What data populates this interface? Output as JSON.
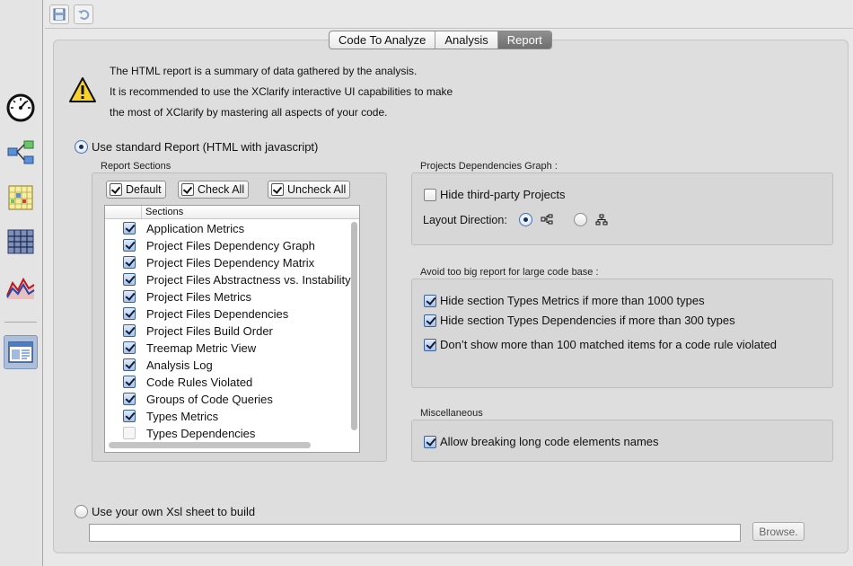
{
  "tabs": [
    "Code To Analyze",
    "Analysis",
    "Report"
  ],
  "active_tab": "Report",
  "sidebar": {
    "items": [
      {
        "icon": "gauge-icon"
      },
      {
        "icon": "dependency-graph-icon"
      },
      {
        "icon": "dependency-matrix-icon"
      },
      {
        "icon": "treemap-icon"
      },
      {
        "icon": "trend-chart-icon"
      },
      {
        "icon": "report-window-icon",
        "selected": true
      }
    ]
  },
  "toolbar": {
    "icons": [
      "save-icon",
      "undo-icon"
    ]
  },
  "info": {
    "line1": "The HTML report is a summary of data gathered by the analysis.",
    "line2": "It is recommended to use the XClarify interactive UI capabilities to make",
    "line3": "the most of XClarify by mastering all aspects of your code."
  },
  "standard_report": {
    "label": "Use standard Report (HTML with javascript)",
    "selected": true
  },
  "report_sections": {
    "title": "Report Sections",
    "buttons": {
      "default": "Default",
      "check_all": "Check All",
      "uncheck_all": "Uncheck All"
    },
    "column_header": "Sections",
    "items": [
      {
        "label": "Application Metrics",
        "checked": true
      },
      {
        "label": "Project Files Dependency Graph",
        "checked": true
      },
      {
        "label": "Project Files Dependency Matrix",
        "checked": true
      },
      {
        "label": "Project Files Abstractness vs. Instability",
        "checked": true
      },
      {
        "label": "Project Files Metrics",
        "checked": true
      },
      {
        "label": "Project Files Dependencies",
        "checked": true
      },
      {
        "label": "Project Files Build Order",
        "checked": true
      },
      {
        "label": "Treemap Metric View",
        "checked": true
      },
      {
        "label": "Analysis Log",
        "checked": true
      },
      {
        "label": "Code Rules Violated",
        "checked": true
      },
      {
        "label": "Groups of Code Queries",
        "checked": true
      },
      {
        "label": "Types Metrics",
        "checked": true
      },
      {
        "label": "Types Dependencies",
        "checked": false
      }
    ]
  },
  "dependencies_graph": {
    "title": "Projects Dependencies Graph :",
    "hide_third_party": {
      "label": "Hide third-party Projects",
      "checked": false
    },
    "layout_direction_label": "Layout Direction:",
    "layout_options": [
      {
        "icon": "left-to-right-layout-icon",
        "selected": true
      },
      {
        "icon": "top-to-bottom-layout-icon",
        "selected": false
      }
    ]
  },
  "big_report": {
    "title": "Avoid too big report for large code base :",
    "options": [
      {
        "label": "Hide section Types Metrics if more than 1000 types",
        "checked": true
      },
      {
        "label": "Hide section Types Dependencies if more than 300 types",
        "checked": true
      },
      {
        "label": "Don’t show more than 100 matched items for a code rule violated",
        "checked": true
      }
    ]
  },
  "misc": {
    "title": "Miscellaneous",
    "allow_breaking": {
      "label": "Allow breaking long code elements names",
      "checked": true
    }
  },
  "custom_xsl": {
    "label": "Use your own Xsl sheet to build",
    "selected": false,
    "value": "",
    "browse_label": "Browse."
  }
}
